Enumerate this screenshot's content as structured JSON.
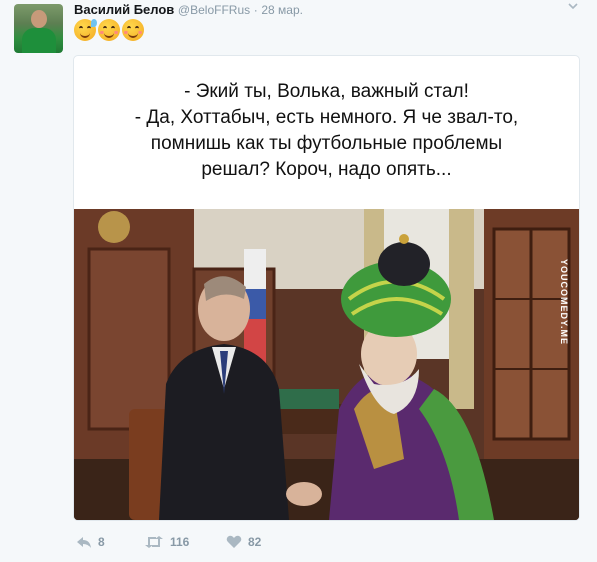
{
  "user": {
    "name": "Василий Белов",
    "handle": "@BeloFFRus",
    "separator": "·",
    "date": "28 мар."
  },
  "tweet": {
    "emojis": [
      "sweat-smile-emoji",
      "smiling-blush-emoji",
      "smiling-blush-emoji"
    ]
  },
  "card": {
    "caption_lines": [
      "- Экий ты, Волька, важный стал!",
      "- Да, Хоттабыч, есть немного. Я че звал-то,",
      "помнишь как ты футбольные проблемы",
      "решал? Короч, надо опять..."
    ],
    "watermark": "YOUCOMEDY.ME"
  },
  "actions": {
    "reply_count": "8",
    "retweet_count": "116",
    "like_count": "82"
  },
  "icons": {
    "reply": "reply-icon",
    "retweet": "retweet-icon",
    "like": "heart-icon",
    "menu": "chevron-down-icon"
  },
  "colors": {
    "name": "#14171a",
    "meta": "#8899a6",
    "icon": "#aab8c2",
    "background": "#f5f8fa"
  }
}
